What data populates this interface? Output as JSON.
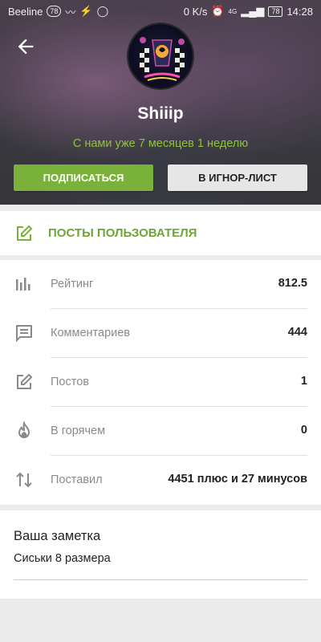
{
  "status_bar": {
    "carrier": "Beeline",
    "carrier_badge": "78",
    "net_speed": "0 K/s",
    "signal": "4G",
    "battery": "78",
    "time": "14:28"
  },
  "profile": {
    "username": "Shiiip",
    "member_since": "С нами уже 7 месяцев 1 неделю",
    "subscribe_label": "ПОДПИСАТЬСЯ",
    "ignore_label": "В ИГНОР-ЛИСТ"
  },
  "posts_link": {
    "label": "ПОСТЫ ПОЛЬЗОВАТЕЛЯ",
    "icon": "edit-square-icon"
  },
  "stats": [
    {
      "icon": "bar-chart-icon",
      "label": "Рейтинг",
      "value": "812.5"
    },
    {
      "icon": "comment-icon",
      "label": "Комментариев",
      "value": "444"
    },
    {
      "icon": "edit-square-icon",
      "label": "Постов",
      "value": "1"
    },
    {
      "icon": "flame-icon",
      "label": "В горячем",
      "value": "0"
    },
    {
      "icon": "swap-vertical-icon",
      "label": "Поставил",
      "value": "4451 плюс и 27 минусов"
    }
  ],
  "note": {
    "title": "Ваша заметка",
    "text": "Сиськи 8 размера"
  },
  "colors": {
    "accent_green": "#79b13b",
    "since_green": "#8fc23d",
    "icon_gray": "#8a8a8a"
  }
}
